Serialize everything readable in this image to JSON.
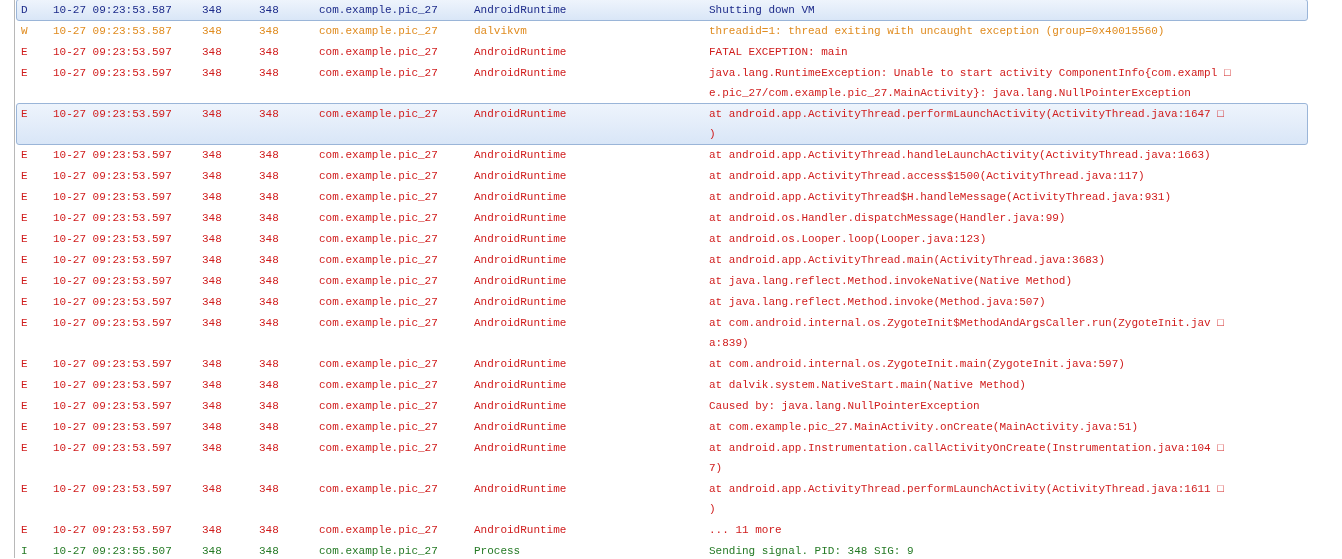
{
  "log_rows": [
    {
      "kind": "debug",
      "level": "D",
      "time": "10-27 09:23:53.587",
      "pid": "348",
      "tid": "348",
      "application": "com.example.pic_27",
      "tag": "AndroidRuntime",
      "text_lines": [
        "Shutting down VM"
      ],
      "selected": true
    },
    {
      "kind": "warn",
      "level": "W",
      "time": "10-27 09:23:53.587",
      "pid": "348",
      "tid": "348",
      "application": "com.example.pic_27",
      "tag": "dalvikvm",
      "text_lines": [
        "threadid=1: thread exiting with uncaught exception (group=0x40015560)"
      ],
      "selected": false
    },
    {
      "kind": "error",
      "level": "E",
      "time": "10-27 09:23:53.597",
      "pid": "348",
      "tid": "348",
      "application": "com.example.pic_27",
      "tag": "AndroidRuntime",
      "text_lines": [
        "FATAL EXCEPTION: main"
      ],
      "selected": false
    },
    {
      "kind": "error",
      "level": "E",
      "time": "10-27 09:23:53.597",
      "pid": "348",
      "tid": "348",
      "application": "com.example.pic_27",
      "tag": "AndroidRuntime",
      "text_lines": [
        "java.lang.RuntimeException: Unable to start activity ComponentInfo{com.exampl □",
        "e.pic_27/com.example.pic_27.MainActivity}: java.lang.NullPointerException"
      ],
      "selected": false
    },
    {
      "kind": "error",
      "level": "E",
      "time": "10-27 09:23:53.597",
      "pid": "348",
      "tid": "348",
      "application": "com.example.pic_27",
      "tag": "AndroidRuntime",
      "text_lines": [
        "at android.app.ActivityThread.performLaunchActivity(ActivityThread.java:1647 □",
        ")"
      ],
      "selected": true
    },
    {
      "kind": "error",
      "level": "E",
      "time": "10-27 09:23:53.597",
      "pid": "348",
      "tid": "348",
      "application": "com.example.pic_27",
      "tag": "AndroidRuntime",
      "text_lines": [
        "at android.app.ActivityThread.handleLaunchActivity(ActivityThread.java:1663)"
      ],
      "selected": false
    },
    {
      "kind": "error",
      "level": "E",
      "time": "10-27 09:23:53.597",
      "pid": "348",
      "tid": "348",
      "application": "com.example.pic_27",
      "tag": "AndroidRuntime",
      "text_lines": [
        "at android.app.ActivityThread.access$1500(ActivityThread.java:117)"
      ],
      "selected": false
    },
    {
      "kind": "error",
      "level": "E",
      "time": "10-27 09:23:53.597",
      "pid": "348",
      "tid": "348",
      "application": "com.example.pic_27",
      "tag": "AndroidRuntime",
      "text_lines": [
        "at android.app.ActivityThread$H.handleMessage(ActivityThread.java:931)"
      ],
      "selected": false
    },
    {
      "kind": "error",
      "level": "E",
      "time": "10-27 09:23:53.597",
      "pid": "348",
      "tid": "348",
      "application": "com.example.pic_27",
      "tag": "AndroidRuntime",
      "text_lines": [
        "at android.os.Handler.dispatchMessage(Handler.java:99)"
      ],
      "selected": false
    },
    {
      "kind": "error",
      "level": "E",
      "time": "10-27 09:23:53.597",
      "pid": "348",
      "tid": "348",
      "application": "com.example.pic_27",
      "tag": "AndroidRuntime",
      "text_lines": [
        "at android.os.Looper.loop(Looper.java:123)"
      ],
      "selected": false
    },
    {
      "kind": "error",
      "level": "E",
      "time": "10-27 09:23:53.597",
      "pid": "348",
      "tid": "348",
      "application": "com.example.pic_27",
      "tag": "AndroidRuntime",
      "text_lines": [
        "at android.app.ActivityThread.main(ActivityThread.java:3683)"
      ],
      "selected": false
    },
    {
      "kind": "error",
      "level": "E",
      "time": "10-27 09:23:53.597",
      "pid": "348",
      "tid": "348",
      "application": "com.example.pic_27",
      "tag": "AndroidRuntime",
      "text_lines": [
        "at java.lang.reflect.Method.invokeNative(Native Method)"
      ],
      "selected": false
    },
    {
      "kind": "error",
      "level": "E",
      "time": "10-27 09:23:53.597",
      "pid": "348",
      "tid": "348",
      "application": "com.example.pic_27",
      "tag": "AndroidRuntime",
      "text_lines": [
        "at java.lang.reflect.Method.invoke(Method.java:507)"
      ],
      "selected": false
    },
    {
      "kind": "error",
      "level": "E",
      "time": "10-27 09:23:53.597",
      "pid": "348",
      "tid": "348",
      "application": "com.example.pic_27",
      "tag": "AndroidRuntime",
      "text_lines": [
        "at com.android.internal.os.ZygoteInit$MethodAndArgsCaller.run(ZygoteInit.jav □",
        "a:839)"
      ],
      "selected": false
    },
    {
      "kind": "error",
      "level": "E",
      "time": "10-27 09:23:53.597",
      "pid": "348",
      "tid": "348",
      "application": "com.example.pic_27",
      "tag": "AndroidRuntime",
      "text_lines": [
        "at com.android.internal.os.ZygoteInit.main(ZygoteInit.java:597)"
      ],
      "selected": false
    },
    {
      "kind": "error",
      "level": "E",
      "time": "10-27 09:23:53.597",
      "pid": "348",
      "tid": "348",
      "application": "com.example.pic_27",
      "tag": "AndroidRuntime",
      "text_lines": [
        "at dalvik.system.NativeStart.main(Native Method)"
      ],
      "selected": false
    },
    {
      "kind": "error",
      "level": "E",
      "time": "10-27 09:23:53.597",
      "pid": "348",
      "tid": "348",
      "application": "com.example.pic_27",
      "tag": "AndroidRuntime",
      "text_lines": [
        "Caused by: java.lang.NullPointerException"
      ],
      "selected": false
    },
    {
      "kind": "error",
      "level": "E",
      "time": "10-27 09:23:53.597",
      "pid": "348",
      "tid": "348",
      "application": "com.example.pic_27",
      "tag": "AndroidRuntime",
      "text_lines": [
        "at com.example.pic_27.MainActivity.onCreate(MainActivity.java:51)"
      ],
      "selected": false
    },
    {
      "kind": "error",
      "level": "E",
      "time": "10-27 09:23:53.597",
      "pid": "348",
      "tid": "348",
      "application": "com.example.pic_27",
      "tag": "AndroidRuntime",
      "text_lines": [
        "at android.app.Instrumentation.callActivityOnCreate(Instrumentation.java:104 □",
        "7)"
      ],
      "selected": false
    },
    {
      "kind": "error",
      "level": "E",
      "time": "10-27 09:23:53.597",
      "pid": "348",
      "tid": "348",
      "application": "com.example.pic_27",
      "tag": "AndroidRuntime",
      "text_lines": [
        "at android.app.ActivityThread.performLaunchActivity(ActivityThread.java:1611 □",
        ")"
      ],
      "selected": false
    },
    {
      "kind": "error",
      "level": "E",
      "time": "10-27 09:23:53.597",
      "pid": "348",
      "tid": "348",
      "application": "com.example.pic_27",
      "tag": "AndroidRuntime",
      "text_lines": [
        "... 11 more"
      ],
      "selected": false
    },
    {
      "kind": "info",
      "level": "I",
      "time": "10-27 09:23:55.507",
      "pid": "348",
      "tid": "348",
      "application": "com.example.pic_27",
      "tag": "Process",
      "text_lines": [
        "Sending signal. PID: 348 SIG: 9"
      ],
      "selected": false
    }
  ]
}
